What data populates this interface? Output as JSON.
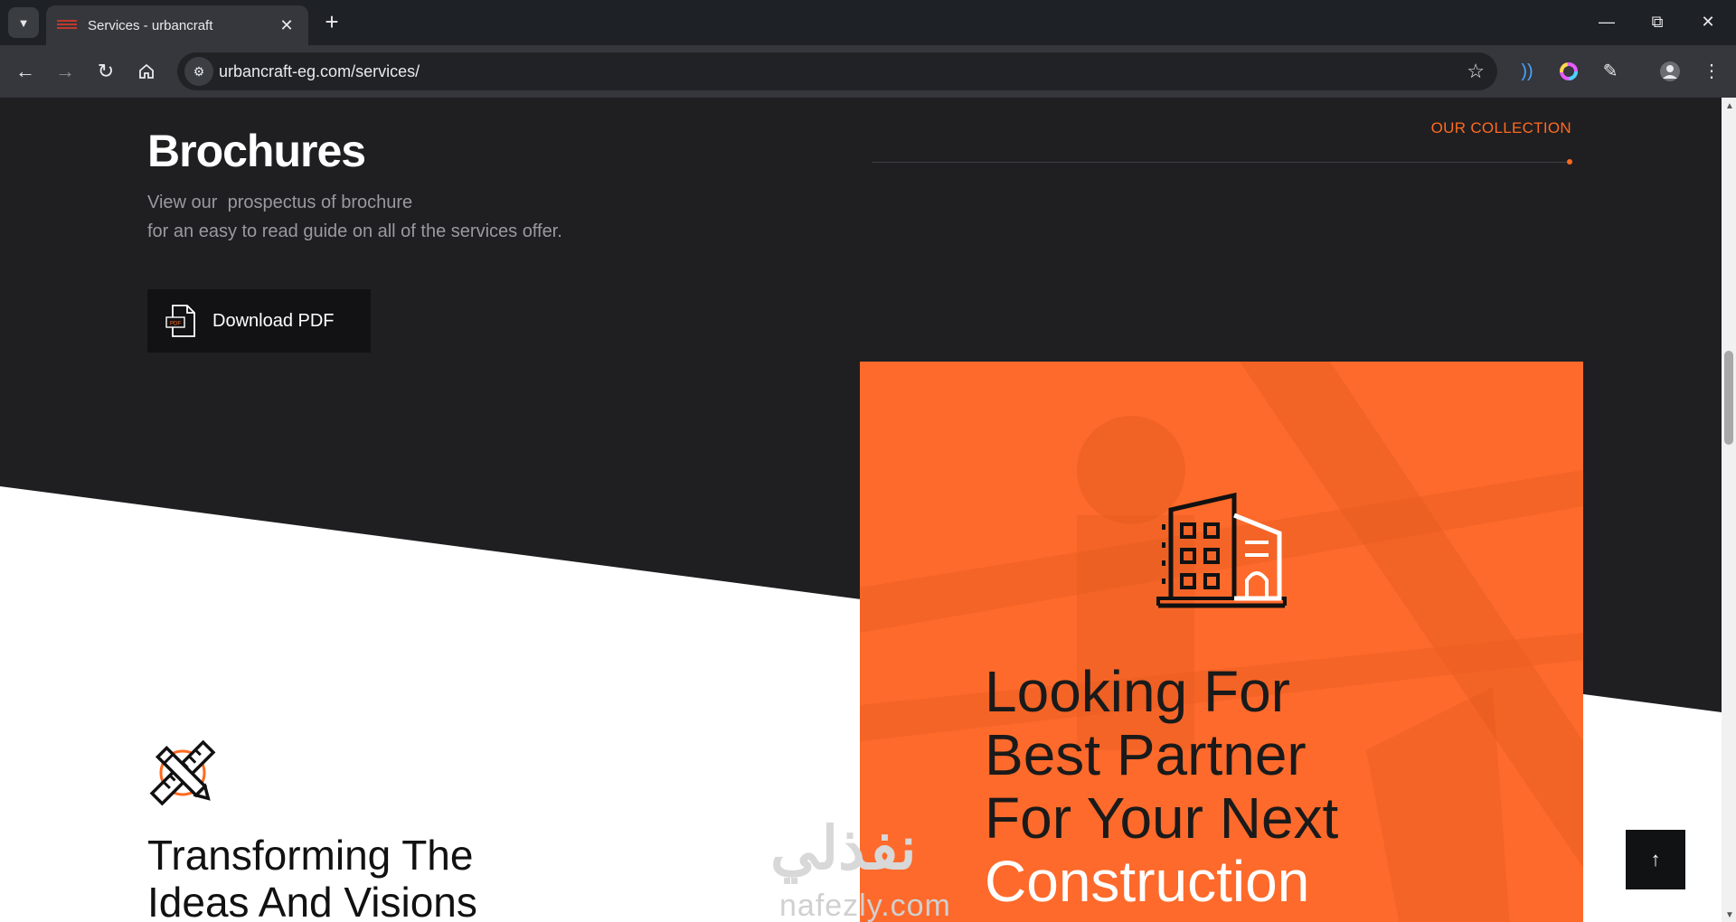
{
  "browser": {
    "tab_title": "Services - urbancraft",
    "new_tab_label": "+",
    "url": "urbancraft-eg.com/services/",
    "icons": {
      "tab_list": "chevron-down-icon",
      "close_tab": "close-icon",
      "back": "arrow-left-icon",
      "forward": "arrow-right-icon",
      "reload": "reload-icon",
      "home": "home-icon",
      "site_info": "tune-icon",
      "bookmark": "star-icon",
      "extensions": "puzzle-icon",
      "profile": "avatar-icon",
      "menu": "kebab-menu-icon"
    },
    "window_controls": [
      "minimize",
      "restore",
      "close"
    ]
  },
  "brochures": {
    "title": "Brochures",
    "desc_line1": "View our  prospectus of brochure",
    "desc_line2": "for an easy to read guide on all of the services offer.",
    "download_label": "Download PDF",
    "pdf_icon_text": "PDF"
  },
  "collection": {
    "label": "OUR COLLECTION"
  },
  "card": {
    "heading_line1": "Looking For",
    "heading_line2": "Best Partner",
    "heading_line3": "For Your Next",
    "heading_line4": "Construction",
    "icon": "building-icon"
  },
  "feature": {
    "icon": "ruler-pencil-icon",
    "title_line1": "Transforming The",
    "title_line2": "Ideas And Visions"
  },
  "watermark": {
    "arabic": "نفذلي",
    "latin": "nafezly.com"
  },
  "colors": {
    "accent": "#fe6a2b",
    "dark_bg": "#1f1f22",
    "white": "#ffffff"
  }
}
